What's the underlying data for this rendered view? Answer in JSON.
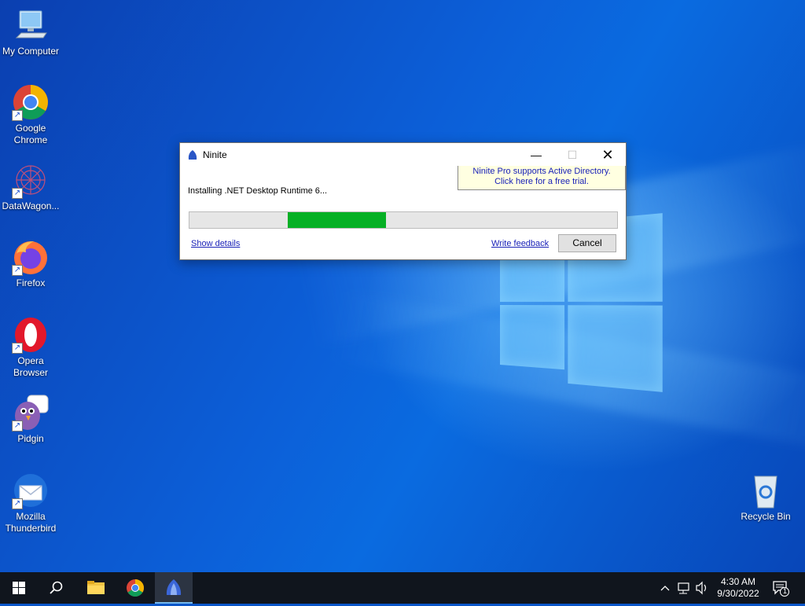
{
  "desktop": {
    "icons": [
      {
        "label": "My Computer",
        "shortcut": false
      },
      {
        "label": "Google Chrome",
        "shortcut": true
      },
      {
        "label": "DataWagon...",
        "shortcut": true
      },
      {
        "label": "Firefox",
        "shortcut": true
      },
      {
        "label": "Opera Browser",
        "shortcut": true
      },
      {
        "label": "Pidgin",
        "shortcut": true
      },
      {
        "label": "Mozilla Thunderbird",
        "shortcut": true
      },
      {
        "label": "Recycle Bin",
        "shortcut": false
      }
    ]
  },
  "dialog": {
    "title": "Ninite",
    "minimize_glyph": "—",
    "maximize_glyph": "☐",
    "close_glyph": "✕",
    "ad_line1": "Ninite Pro supports Active Directory.",
    "ad_line2": "Click here for a free trial.",
    "status": "Installing .NET Desktop Runtime 6...",
    "progress": {
      "segment_start_fraction": 0.23,
      "segment_end_fraction": 0.46,
      "color": "#06b025"
    },
    "show_details": "Show details",
    "write_feedback": "Write feedback",
    "cancel": "Cancel"
  },
  "taskbar": {
    "pinned": [
      "start-icon",
      "search-icon",
      "file-explorer-icon",
      "chrome-icon",
      "ninite-icon"
    ],
    "active": "ninite-icon",
    "clock_time": "4:30 AM",
    "clock_date": "9/30/2022",
    "notification_count": "1"
  },
  "colors": {
    "accent": "#0a56c9",
    "link": "#1a22b8",
    "taskbar": "#10151d"
  }
}
